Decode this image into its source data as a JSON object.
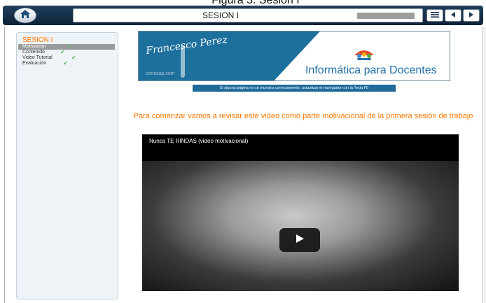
{
  "caption": "Figura 3. Sesión I",
  "topbar": {
    "title": "SESION I",
    "progress": 1.0
  },
  "sidebar": {
    "title": "SESION I",
    "items": [
      {
        "label": "Motivación",
        "active": true,
        "checked": true
      },
      {
        "label": "Contenido",
        "active": false,
        "checked": true
      },
      {
        "label": "Video Tutorial",
        "active": false,
        "checked": true
      },
      {
        "label": "Evaluación",
        "active": false,
        "checked": true
      }
    ]
  },
  "banner": {
    "script_text": "Francesco Perez",
    "site_text": "cenecap.com",
    "brand": "Informática para Docentes"
  },
  "notice": "Si alguna página no se muestra correctamente, actualizar el navegador con la Tecla F5",
  "intro": "Para comenzar vamos a revisar este video como parte motivacional de la primera sesión de trabajo",
  "video": {
    "title": "Nunca TE RINDAS (video motivacional)"
  },
  "icons": {
    "home": "home-icon",
    "menu": "list-icon",
    "prev": "chevron-left-icon",
    "next": "chevron-right-icon",
    "play": "play-icon",
    "check": "check-icon"
  }
}
